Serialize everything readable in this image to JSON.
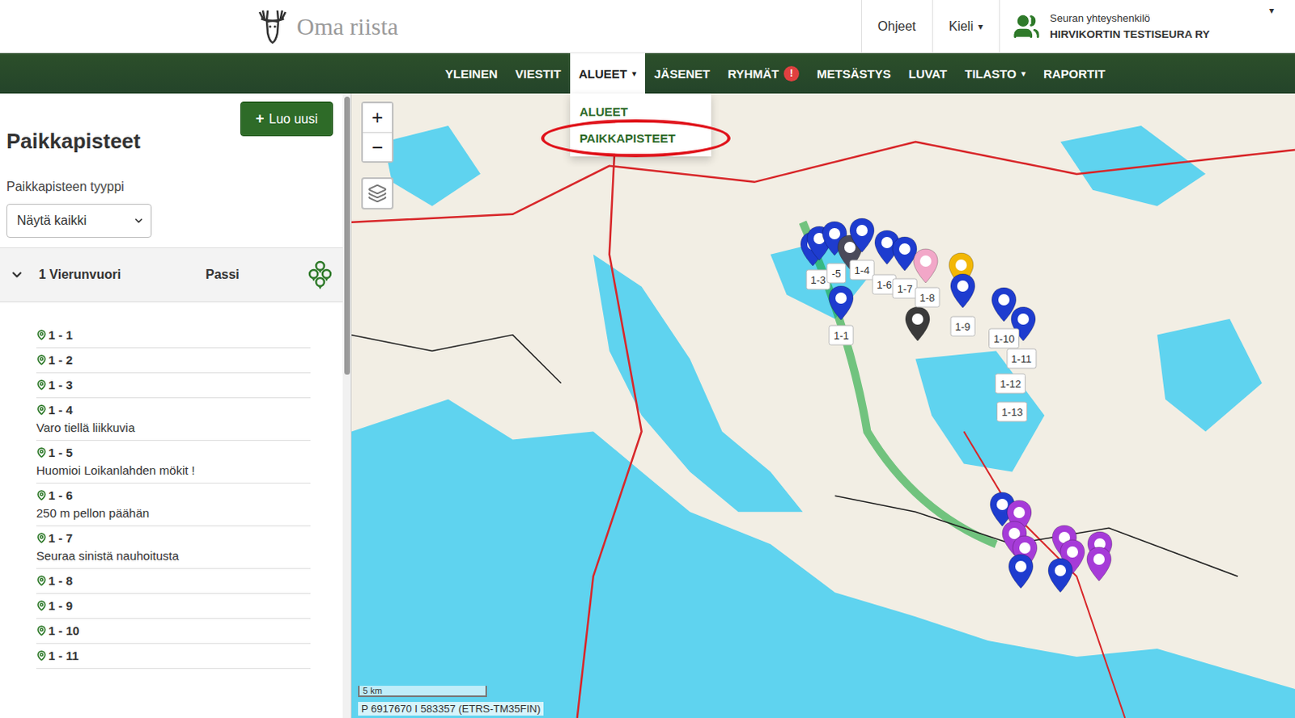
{
  "header": {
    "logo": "Oma riista",
    "links": [
      {
        "label": "Ohjeet",
        "caret": ""
      },
      {
        "label": "Kieli",
        "caret": "▾"
      }
    ],
    "account": {
      "role": "Seuran yhteyshenkilö",
      "name": "HIRVIKORTIN TESTISEURA RY",
      "caret": "▾"
    }
  },
  "nav": [
    {
      "label": "YLEINEN",
      "selected": false,
      "caret": "",
      "badge": ""
    },
    {
      "label": "VIESTIT",
      "selected": false,
      "caret": "",
      "badge": ""
    },
    {
      "label": "ALUEET",
      "selected": true,
      "caret": "▾",
      "badge": ""
    },
    {
      "label": "JÄSENET",
      "selected": false,
      "caret": "",
      "badge": ""
    },
    {
      "label": "RYHMÄT",
      "selected": false,
      "caret": "",
      "badge": "!"
    },
    {
      "label": "METSÄSTYS",
      "selected": false,
      "caret": "",
      "badge": ""
    },
    {
      "label": "LUVAT",
      "selected": false,
      "caret": "",
      "badge": ""
    },
    {
      "label": "TILASTO",
      "selected": false,
      "caret": "▾",
      "badge": ""
    },
    {
      "label": "RAPORTIT",
      "selected": false,
      "caret": "",
      "badge": ""
    }
  ],
  "dropdown": {
    "items": [
      {
        "label": "ALUEET",
        "highlighted": false
      },
      {
        "label": "PAIKKAPISTEET",
        "highlighted": true
      }
    ]
  },
  "sidebar": {
    "title": "Paikkapisteet",
    "create_button": {
      "icon": "+",
      "label": "Luo uusi"
    },
    "filter": {
      "label": "Paikkapisteen tyyppi",
      "value": "Näytä kaikki"
    },
    "group": {
      "name": "1 Vierunvuori",
      "type": "Passi",
      "expanded": true
    },
    "points": [
      {
        "label": "1 - 1",
        "note": ""
      },
      {
        "label": "1 - 2",
        "note": ""
      },
      {
        "label": "1 - 3",
        "note": ""
      },
      {
        "label": "1 - 4",
        "note": "Varo tiellä liikkuvia"
      },
      {
        "label": "1 - 5",
        "note": "Huomioi Loikanlahden mökit !"
      },
      {
        "label": "1 - 6",
        "note": "250 m pellon päähän"
      },
      {
        "label": "1 - 7",
        "note": "Seuraa sinistä nauhoitusta"
      },
      {
        "label": "1 - 8",
        "note": ""
      },
      {
        "label": "1 - 9",
        "note": ""
      },
      {
        "label": "1 - 10",
        "note": ""
      },
      {
        "label": "1 - 11",
        "note": ""
      }
    ]
  },
  "map": {
    "zoom_in": "+",
    "zoom_out": "−",
    "scale": "5 km",
    "coordinates": "P 6917670 I 583357 (ETRS-TM35FIN)",
    "pins": [
      {
        "color": "#1e3ccf"
      },
      {
        "color": "#1e3ccf"
      },
      {
        "color": "#1e3ccf"
      },
      {
        "color": "#4a4a5a"
      },
      {
        "color": "#1e3ccf"
      },
      {
        "color": "#1e3ccf"
      },
      {
        "color": "#1e3ccf"
      },
      {
        "color": "#f2a7c8"
      },
      {
        "color": "#f2b705"
      },
      {
        "color": "#1e3ccf"
      },
      {
        "color": "#3a3a3a"
      },
      {
        "color": "#1e3ccf"
      },
      {
        "color": "#1e3ccf"
      },
      {
        "color": "#1e3ccf"
      },
      {
        "color": "#1e3ccf"
      },
      {
        "color": "#a63bd8"
      },
      {
        "color": "#a63bd8"
      },
      {
        "color": "#a63bd8"
      },
      {
        "color": "#1e3ccf"
      },
      {
        "color": "#a63bd8"
      },
      {
        "color": "#a63bd8"
      },
      {
        "color": "#1e3ccf"
      },
      {
        "color": "#a63bd8"
      },
      {
        "color": "#a63bd8"
      }
    ],
    "labels": [
      "1-1",
      "1-3",
      "-5",
      "1-4",
      "1-6",
      "1-7",
      "1-8",
      "1-9",
      "1-10",
      "1-11",
      "1-12",
      "1-13"
    ]
  }
}
